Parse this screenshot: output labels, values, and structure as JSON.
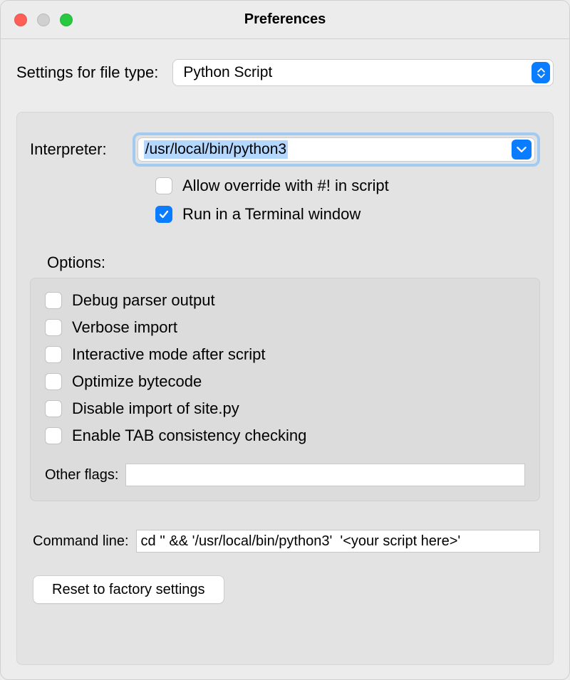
{
  "window": {
    "title": "Preferences"
  },
  "fileType": {
    "label": "Settings for file type:",
    "selected": "Python Script"
  },
  "interpreter": {
    "label": "Interpreter:",
    "value": "/usr/local/bin/python3",
    "allowOverride": {
      "label": "Allow override with #! in script",
      "checked": false
    },
    "runInTerminal": {
      "label": "Run in a Terminal window",
      "checked": true
    }
  },
  "options": {
    "label": "Options:",
    "items": [
      {
        "label": "Debug parser output",
        "checked": false
      },
      {
        "label": "Verbose import",
        "checked": false
      },
      {
        "label": "Interactive mode after script",
        "checked": false
      },
      {
        "label": "Optimize bytecode",
        "checked": false
      },
      {
        "label": "Disable import of site.py",
        "checked": false
      },
      {
        "label": "Enable TAB consistency checking",
        "checked": false
      }
    ],
    "otherFlags": {
      "label": "Other flags:",
      "value": ""
    }
  },
  "commandLine": {
    "label": "Command line:",
    "value": "cd '' && '/usr/local/bin/python3'  '<your script here>'"
  },
  "reset": {
    "label": "Reset to factory settings"
  }
}
